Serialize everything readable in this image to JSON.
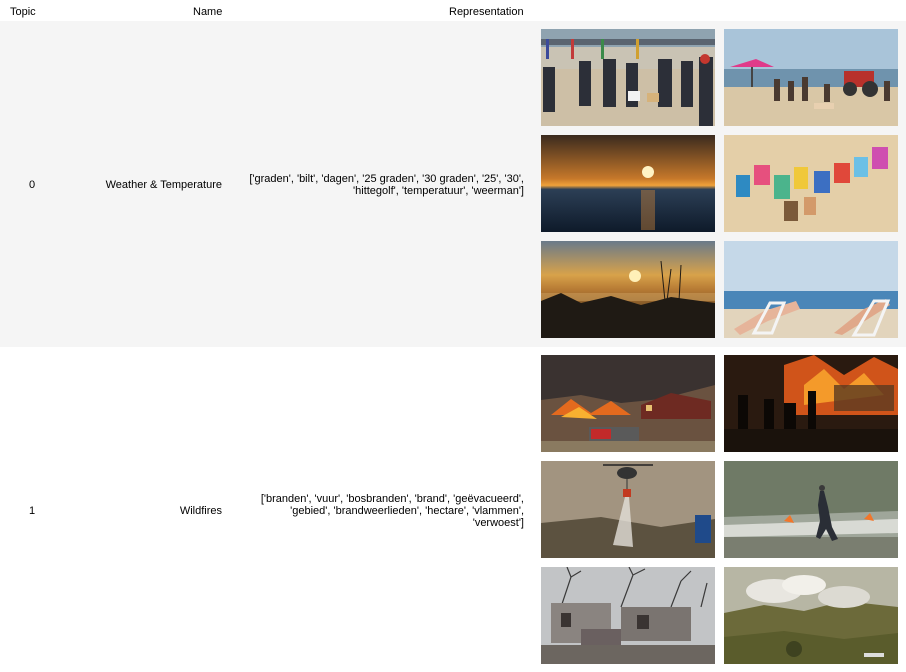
{
  "columns": {
    "topic": "Topic",
    "name": "Name",
    "representation": "Representation"
  },
  "rows": [
    {
      "topic": "0",
      "name": "Weather & Temperature",
      "representation": "['graden', 'bilt', 'dagen', '25 graden', '30 graden', '25', '30',\n'hittegolf', 'temperatuur', 'weerman']",
      "images": [
        "beach-crowd-with-dogs-photo",
        "beach-with-tractor-photo",
        "sunset-over-sea-photo",
        "aerial-beach-sunbathers-photo",
        "sunset-over-marsh-photo",
        "people-in-beach-chairs-photo"
      ]
    },
    {
      "topic": "1",
      "name": "Wildfires",
      "representation": "['branden', 'vuur', 'bosbranden', 'brand', 'geëvacueerd',\n'gebied', 'brandweerlieden', 'hectare', 'vlammen',\n'verwoest']",
      "images": [
        "fire-near-house-photo",
        "firefighters-at-night-photo",
        "helicopter-water-drop-photo",
        "person-fleeing-smoke-photo",
        "burnt-house-ruins-photo",
        "smoke-over-hills-photo"
      ]
    }
  ]
}
